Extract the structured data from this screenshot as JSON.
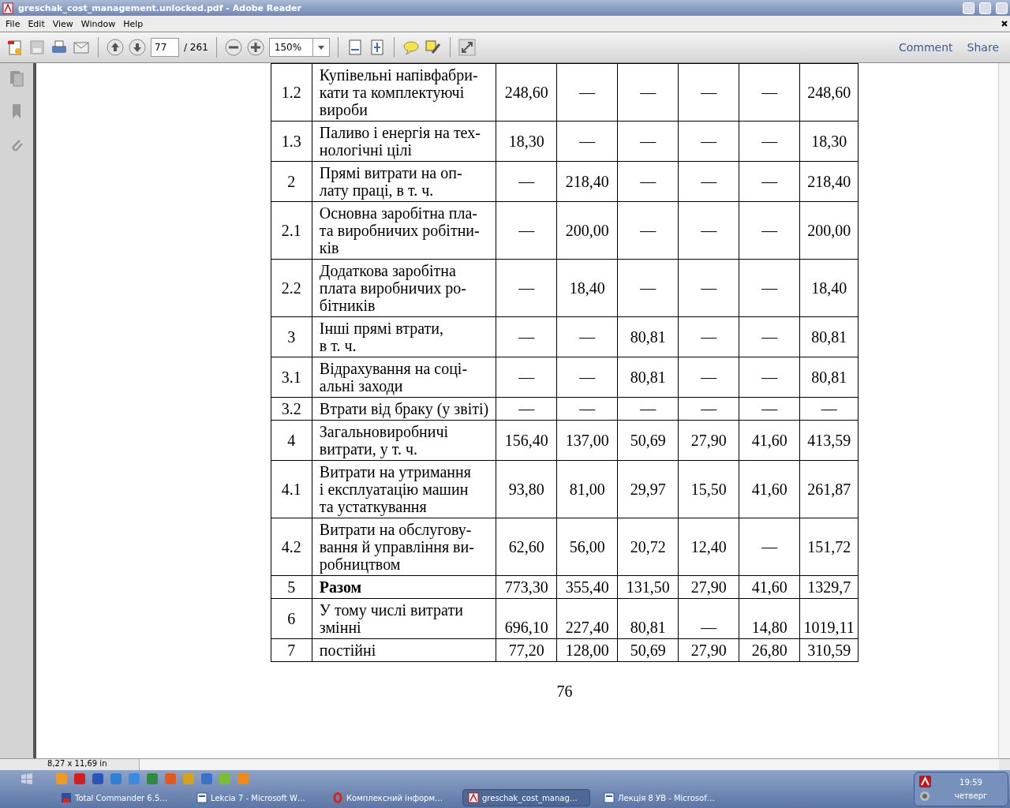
{
  "window": {
    "title": "greschak_cost_management.unlocked.pdf - Adobe Reader"
  },
  "menu": [
    "File",
    "Edit",
    "View",
    "Window",
    "Help"
  ],
  "toolbar": {
    "page": "77",
    "page_count": "/ 261",
    "zoom": "150%",
    "links": [
      "Comment",
      "Share"
    ]
  },
  "table": {
    "rows": [
      {
        "kind": "item",
        "number": "1.2",
        "text": "Купівельні напівфабри-\nкати та комплектуючі\nвироби",
        "values": [
          "248,60",
          "—",
          "—",
          "—",
          "—",
          "248,60"
        ]
      },
      {
        "kind": "item",
        "number": "1.3",
        "text": "Паливо і енергія на тех-\nнологічні цілі",
        "values": [
          "18,30",
          "—",
          "—",
          "—",
          "—",
          "18,30"
        ]
      },
      {
        "kind": "item",
        "number": "2",
        "text": "Прямі витрати на оп-\nлату праці, в т. ч.",
        "values": [
          "—",
          "218,40",
          "—",
          "—",
          "—",
          "218,40"
        ]
      },
      {
        "kind": "item",
        "number": "2.1",
        "text": "Основна заробітна пла-\nта виробничих робітни-\nків",
        "values": [
          "—",
          "200,00",
          "—",
          "—",
          "—",
          "200,00"
        ]
      },
      {
        "kind": "item",
        "number": "2.2",
        "text": "Додаткова заробітна\nплата виробничих ро-\nбітників",
        "values": [
          "—",
          "18,40",
          "—",
          "—",
          "—",
          "18,40"
        ]
      },
      {
        "kind": "item",
        "number": "3",
        "text": "Інші прямі втрати,\nв т. ч.",
        "values": [
          "—",
          "—",
          "80,81",
          "—",
          "—",
          "80,81"
        ]
      },
      {
        "kind": "item",
        "number": "3.1",
        "text": "Відрахування на соці-\nальні заходи",
        "values": [
          "—",
          "—",
          "80,81",
          "—",
          "—",
          "80,81"
        ]
      },
      {
        "kind": "item",
        "number": "3.2",
        "text": "Втрати від браку (у звіті)",
        "values": [
          "—",
          "—",
          "—",
          "—",
          "—",
          "—"
        ]
      },
      {
        "kind": "item",
        "number": "4",
        "text": "Загальновиробничі\nвитрати, у т. ч.",
        "values": [
          "156,40",
          "137,00",
          "50,69",
          "27,90",
          "41,60",
          "413,59"
        ]
      },
      {
        "kind": "item",
        "number": "4.1",
        "text": "Витрати на утримання\nі експлуатацію машин\nта устаткування",
        "values": [
          "93,80",
          "81,00",
          "29,97",
          "15,50",
          "41,60",
          "261,87"
        ]
      },
      {
        "kind": "item",
        "number": "4.2",
        "text": "Витрати на обслугову-\nвання й управління ви-\nробництвом",
        "values": [
          "62,60",
          "56,00",
          "20,72",
          "12,40",
          "—",
          "151,72"
        ]
      },
      {
        "kind": "total",
        "number": "5",
        "text": "Разом",
        "values": [
          "773,30",
          "355,40",
          "131,50",
          "27,90",
          "41,60",
          "1329,7"
        ]
      },
      {
        "kind": "lower",
        "number": "6",
        "text": "У тому числі витрати\nзмінні",
        "values": [
          "696,10",
          "227,40",
          "80,81",
          "—",
          "14,80",
          "1019,11"
        ]
      },
      {
        "kind": "item",
        "number": "7",
        "text": "постійні",
        "values": [
          "77,20",
          "128,00",
          "50,69",
          "27,90",
          "26,80",
          "310,59"
        ]
      }
    ]
  },
  "page_number": "76",
  "status_bar": {
    "page_size": "8,27 x 11,69 in"
  },
  "taskbar": {
    "tasks": [
      {
        "kind": "commander",
        "label": "Total Commander 6.5…",
        "selected": false
      },
      {
        "kind": "word",
        "label": "Lekcia 7 - Microsoft W…",
        "selected": false
      },
      {
        "kind": "opera",
        "label": "Комплексний інформ…",
        "selected": false
      },
      {
        "kind": "pdf",
        "label": "greschak_cost_manag…",
        "selected": true
      },
      {
        "kind": "word",
        "label": "Лекція 8 УВ - Microsof…",
        "selected": false
      }
    ],
    "clock": {
      "time": "19:59",
      "day": "четверг"
    }
  }
}
